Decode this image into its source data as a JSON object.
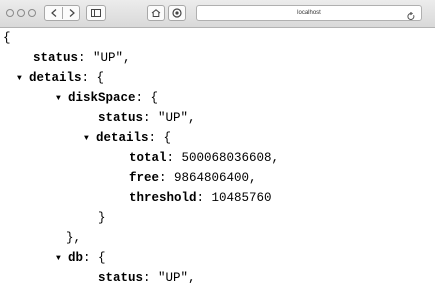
{
  "window": {
    "address": "localhost"
  },
  "json": {
    "root_open": "{",
    "status_key": "status",
    "status_value": "\"UP\",",
    "details_key": "details",
    "disk_key": "diskSpace",
    "disk_status_key": "status",
    "disk_status_value": "\"UP\",",
    "disk_details_key": "details",
    "total_key": "total",
    "total_value": "500068036608,",
    "free_key": "free",
    "free_value": "9864806400,",
    "threshold_key": "threshold",
    "threshold_value": "10485760",
    "disk_details_close": "}",
    "disk_close": "},",
    "db_key": "db",
    "db_status_key": "status",
    "db_status_value": "\"UP\",",
    "colon_open": ": {",
    "colon": ": "
  },
  "icons": {
    "collapse": "triangle-down-icon"
  }
}
